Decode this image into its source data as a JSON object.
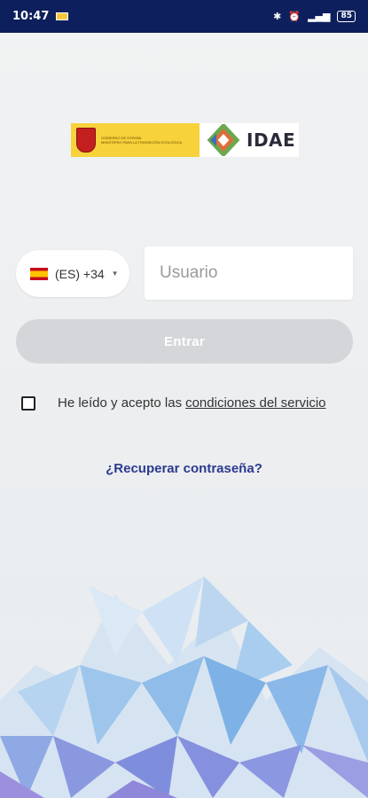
{
  "status_bar": {
    "time": "10:47",
    "battery": "85"
  },
  "logo": {
    "gobierno_text": "GOBIERNO DE ESPAÑA",
    "ministerio_text": "MINISTERIO PARA LA TRANSICIÓN ECOLÓGICA",
    "idae_text": "IDAE"
  },
  "login": {
    "country_label": "(ES) +34",
    "username_placeholder": "Usuario",
    "enter_label": "Entrar",
    "terms_prefix": "He leído y acepto las",
    "terms_link": "condiciones del servicio",
    "recover_label": "¿Recuperar contraseña?"
  },
  "colors": {
    "status_bar_bg": "#0d1f5c",
    "link_color": "#2b3a8f",
    "button_disabled": "#d4d6d9"
  }
}
